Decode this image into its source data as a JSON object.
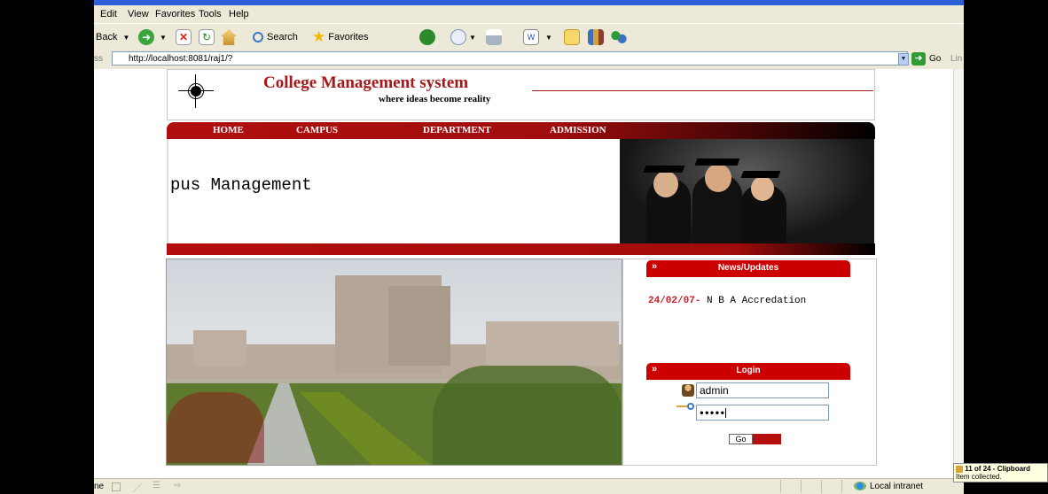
{
  "browser": {
    "menu": [
      "Edit",
      "View",
      "Favorites",
      "Tools",
      "Help"
    ],
    "toolbar": {
      "back_label": "Back",
      "search_label": "Search",
      "favorites_label": "Favorites"
    },
    "address": {
      "label": "ss",
      "url": "http://localhost:8081/raj1/?",
      "go_label": "Go",
      "links_label": "Lin"
    },
    "status": {
      "left_text": "ne",
      "zone_text": "Local intranet"
    }
  },
  "site": {
    "title": "College Management system",
    "tagline": "where ideas become reality",
    "nav": [
      "HOME",
      "CAMPUS",
      "DEPARTMENT",
      "ADMISSION"
    ],
    "marquee_text": "pus Management",
    "news": {
      "header": "News/Updates",
      "items": [
        {
          "date": "24/02/07-",
          "text": " N B A Accredation"
        }
      ]
    },
    "login": {
      "header": "Login",
      "username_value": "admin",
      "password_value": "●●●●●",
      "go_label": "Go"
    }
  },
  "notification": {
    "title": "11 of 24 - Clipboard",
    "subtitle": "Item collected."
  }
}
